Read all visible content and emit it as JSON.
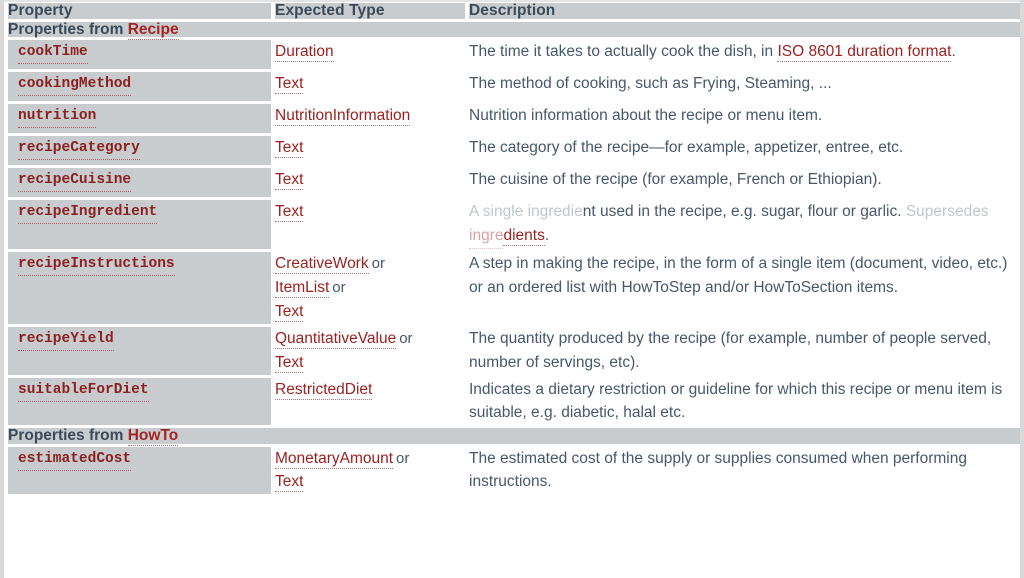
{
  "table": {
    "columns": [
      {
        "id": "property",
        "label": "Property"
      },
      {
        "id": "expected_type",
        "label": "Expected Type"
      },
      {
        "id": "description",
        "label": "Description"
      }
    ],
    "sections": [
      {
        "band_prefix": "Properties from ",
        "band_link": "Recipe",
        "rows": [
          {
            "property": "cookTime",
            "types": [
              {
                "text": "Duration",
                "link": true
              }
            ],
            "description_parts": [
              {
                "text": "The time it takes to actually cook the dish, in ",
                "link": false
              },
              {
                "text": "ISO 8601 duration format",
                "link": true
              },
              {
                "text": ".",
                "link": false
              }
            ]
          },
          {
            "property": "cookingMethod",
            "types": [
              {
                "text": "Text",
                "link": true
              }
            ],
            "description_parts": [
              {
                "text": "The method of cooking, such as Frying, Steaming, ...",
                "link": false
              }
            ]
          },
          {
            "property": "nutrition",
            "types": [
              {
                "text": "NutritionInformation",
                "link": true
              }
            ],
            "description_parts": [
              {
                "text": "Nutrition information about the recipe or menu item.",
                "link": false
              }
            ]
          },
          {
            "property": "recipeCategory",
            "types": [
              {
                "text": "Text",
                "link": true
              }
            ],
            "description_parts": [
              {
                "text": "The category of the recipe—for example, appetizer, entree, etc.",
                "link": false
              }
            ]
          },
          {
            "property": "recipeCuisine",
            "types": [
              {
                "text": "Text",
                "link": true
              }
            ],
            "description_parts": [
              {
                "text": "The cuisine of the recipe (for example, French or Ethiopian).",
                "link": false
              }
            ]
          },
          {
            "property": "recipeIngredient",
            "types": [
              {
                "text": "Text",
                "link": true
              }
            ],
            "description_parts": [
              {
                "text": "A single ingredie",
                "link": false,
                "faint": true
              },
              {
                "text": "nt used in the recipe, e.g. sugar, flour or garlic. ",
                "link": false
              },
              {
                "text": "Supersedes ",
                "link": false,
                "faint": true
              },
              {
                "text": "ingre",
                "link": true,
                "faint": true
              },
              {
                "text": "dients",
                "link": true
              },
              {
                "text": ".",
                "link": false
              }
            ]
          },
          {
            "property": "recipeInstructions",
            "types": [
              {
                "text": "CreativeWork",
                "link": true,
                "or": true
              },
              {
                "text": "ItemList",
                "link": true,
                "or": true
              },
              {
                "text": "Text",
                "link": true
              }
            ],
            "description_parts": [
              {
                "text": "A step in making the recipe, in the form of a single item (document, video, etc.) or an ordered list with HowToStep and/or HowToSection items.",
                "link": false
              }
            ]
          },
          {
            "property": "recipeYield",
            "types": [
              {
                "text": "QuantitativeValue",
                "link": true,
                "or": true
              },
              {
                "text": "Text",
                "link": true
              }
            ],
            "description_parts": [
              {
                "text": "The quantity produced by the recipe (for example, number of people served, number of servings, etc).",
                "link": false
              }
            ]
          },
          {
            "property": "suitableForDiet",
            "types": [
              {
                "text": "RestrictedDiet",
                "link": true
              }
            ],
            "description_parts": [
              {
                "text": "Indicates a dietary restriction or guideline for which this recipe or menu item is suitable, e.g. diabetic, halal etc.",
                "link": false
              }
            ]
          }
        ]
      },
      {
        "band_prefix": "Properties from ",
        "band_link": "HowTo",
        "rows": [
          {
            "property": "estimatedCost",
            "types": [
              {
                "text": "MonetaryAmount",
                "link": true,
                "or": true
              },
              {
                "text": "Text",
                "link": true
              }
            ],
            "description_parts": [
              {
                "text": "The estimated cost of the supply or supplies consumed when performing instructions.",
                "link": false
              }
            ]
          }
        ]
      }
    ]
  },
  "ortext": "or",
  "colors": {
    "band_background": "#c8ccce",
    "header_background": "#c8ccce",
    "property_background": "#c8ccce",
    "link_red": "#9a2222",
    "property_red": "#8c2020",
    "body_text": "#46586a",
    "heading_text": "#3a4a5a",
    "page_background": "#ffffff",
    "page_edge": "#d9d9d9"
  }
}
